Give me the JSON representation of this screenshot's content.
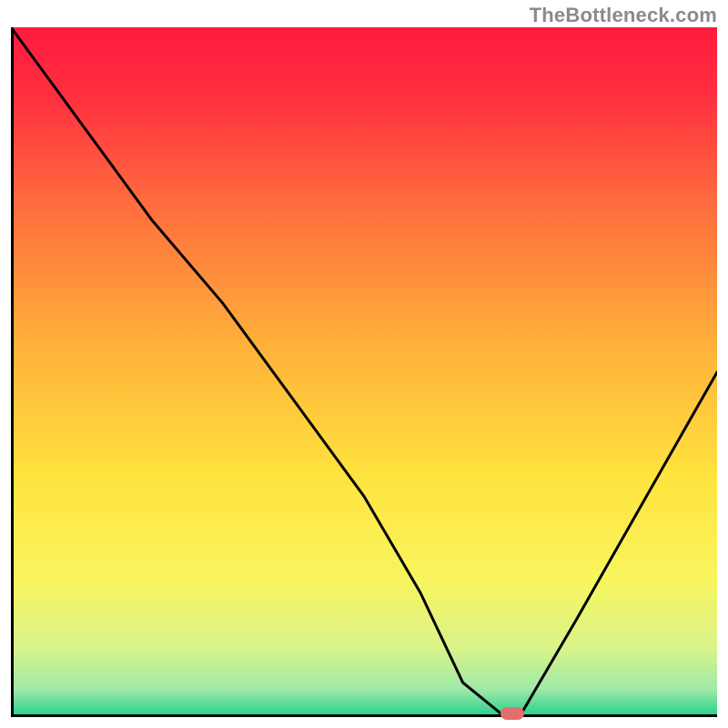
{
  "watermark": "TheBottleneck.com",
  "chart_data": {
    "type": "line",
    "title": "",
    "xlabel": "",
    "ylabel": "",
    "xlim": [
      0,
      100
    ],
    "ylim": [
      0,
      100
    ],
    "series": [
      {
        "name": "bottleneck-curve",
        "x": [
          0,
          10,
          20,
          30,
          40,
          50,
          58,
          64,
          70,
          72,
          80,
          90,
          100
        ],
        "y": [
          100,
          86,
          72,
          60,
          46,
          32,
          18,
          5,
          0,
          0,
          14,
          32,
          50
        ]
      }
    ],
    "marker": {
      "x": 71,
      "y": 0
    },
    "background": {
      "type": "vertical-gradient",
      "stops": [
        {
          "pos": 0.0,
          "color": "#ff1a3d"
        },
        {
          "pos": 0.1,
          "color": "#ff2f3f"
        },
        {
          "pos": 0.25,
          "color": "#ff6a3e"
        },
        {
          "pos": 0.45,
          "color": "#ffad3a"
        },
        {
          "pos": 0.65,
          "color": "#ffe33e"
        },
        {
          "pos": 0.8,
          "color": "#f8f55e"
        },
        {
          "pos": 0.9,
          "color": "#d8f48a"
        },
        {
          "pos": 0.96,
          "color": "#9fe9a8"
        },
        {
          "pos": 1.0,
          "color": "#1fd08a"
        }
      ]
    }
  }
}
